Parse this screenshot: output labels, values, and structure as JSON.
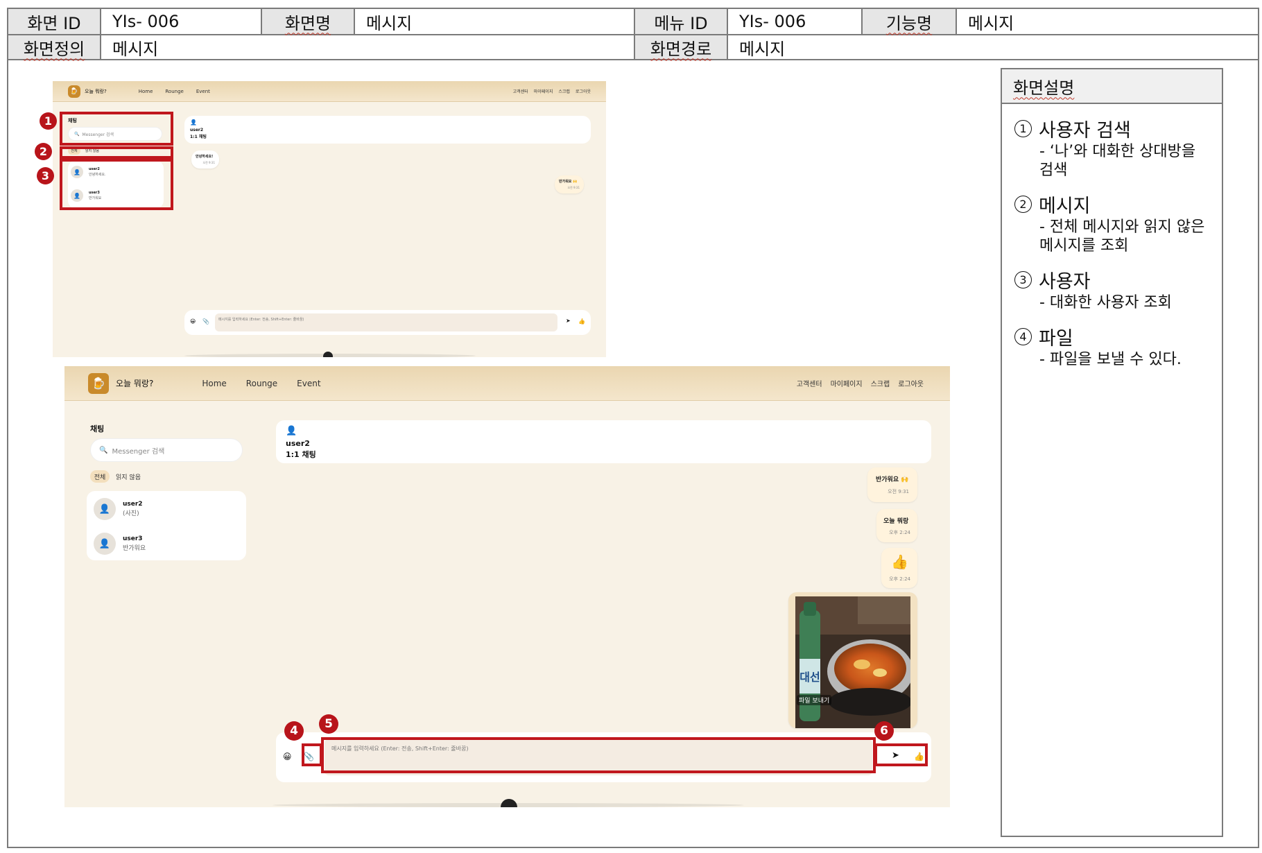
{
  "header": {
    "row1": {
      "screen_id_label": "화면 ID",
      "screen_id": "YIs- 006",
      "screen_name_label": "화면명",
      "screen_name": "메시지",
      "menu_id_label": "메뉴 ID",
      "menu_id": "YIs- 006",
      "function_name_label": "기능명",
      "function_name": "메시지"
    },
    "row2": {
      "screen_def_label": "화면정의",
      "screen_def": "메시지",
      "screen_path_label": "화면경로",
      "screen_path": "메시지"
    }
  },
  "description": {
    "title": "화면설명",
    "items": [
      {
        "num": "1",
        "title": "사용자 검색",
        "text1": "- ‘나’와 대화한 상대방을",
        "text2": "검색"
      },
      {
        "num": "2",
        "title": "메시지",
        "text1": "- 전체 메시지와 읽지 않은",
        "text2": "메시지를 조회"
      },
      {
        "num": "3",
        "title": "사용자",
        "text1": "- 대화한 사용자 조회",
        "text2": ""
      },
      {
        "num": "4",
        "title": "파일",
        "text1": "- 파일을 보낼 수 있다.",
        "text2": ""
      }
    ]
  },
  "app": {
    "logo_text": "오늘 뭐랑?",
    "nav": [
      "Home",
      "Rounge",
      "Event"
    ],
    "right_nav": [
      "고객센터",
      "마이페이지",
      "스크랩",
      "로그아웃"
    ],
    "chat_title": "채팅",
    "search_placeholder": "Messenger 검색",
    "filters": [
      "전체",
      "읽지 않음"
    ],
    "contacts_small": [
      {
        "name": "user2",
        "preview": "안녕하세요."
      },
      {
        "name": "user3",
        "preview": "반가워요"
      }
    ],
    "contacts_large": [
      {
        "name": "user2",
        "preview": "(사진)"
      },
      {
        "name": "user3",
        "preview": "반가워요"
      }
    ],
    "chat_user": "user2",
    "chat_type": "1:1 채팅",
    "small_messages": [
      {
        "text": "안녕하세요!",
        "time": "오전 9:31"
      },
      {
        "text": "반가워요 🙌",
        "time": "오전 9:31"
      }
    ],
    "large_messages": [
      {
        "text": "반가워요 🙌",
        "time": "오전 9:31"
      },
      {
        "text": "오늘 뭐랑",
        "time": "오후 2:24"
      },
      {
        "text": "👍",
        "time": "오후 2:24"
      }
    ],
    "photo_caption": "파일 보내기",
    "photo_bottle_text": "대선",
    "input_placeholder": "메시지를 입력하세요 (Enter: 전송, Shift+Enter: 줄바꿈)",
    "emoji_icon": "😀",
    "attach_icon": "📎",
    "send_icon": "➤",
    "like_icon": "👍",
    "person_icon": "👤",
    "search_icon": "🔍",
    "scroll_icon": "⌄"
  },
  "badges": [
    "1",
    "2",
    "3",
    "4",
    "5",
    "6"
  ],
  "colors": {
    "annotation_red": "#c0171d",
    "app_bg": "#f8f2e6",
    "bubble_mine": "#fff3dd"
  }
}
